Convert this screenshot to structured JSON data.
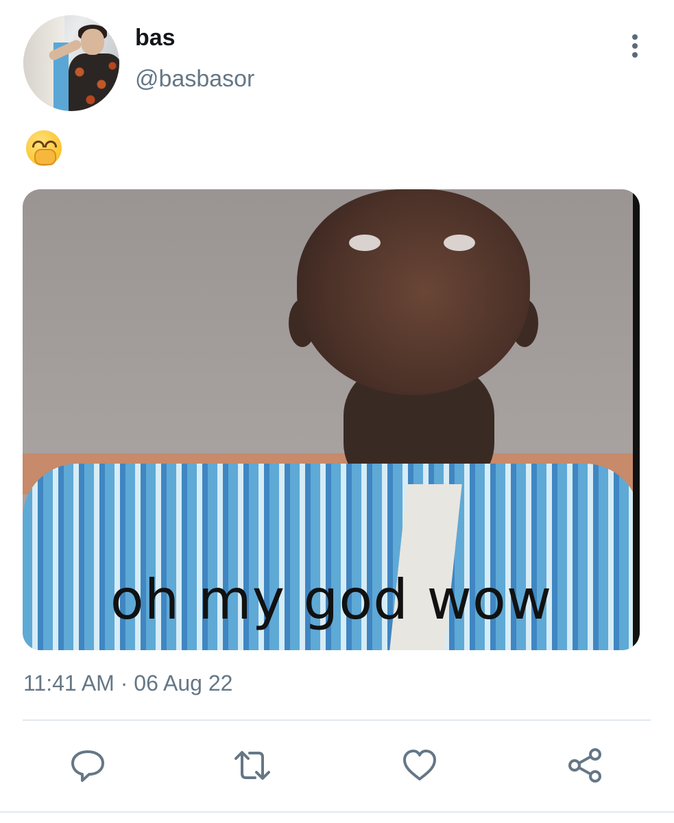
{
  "tweet": {
    "display_name": "bas",
    "handle": "@basbasor",
    "text_emoji": "🤭",
    "media_caption": "oh my god wow",
    "timestamp": "11:41 AM · 06 Aug 22"
  },
  "actions": {
    "reply_icon": "speech-bubble-icon",
    "retweet_icon": "retweet-icon",
    "like_icon": "heart-icon",
    "share_icon": "share-icon"
  },
  "colors": {
    "primary_text": "#14171a",
    "secondary_text": "#657786",
    "icon": "#657786",
    "divider": "#e1e8ed"
  }
}
